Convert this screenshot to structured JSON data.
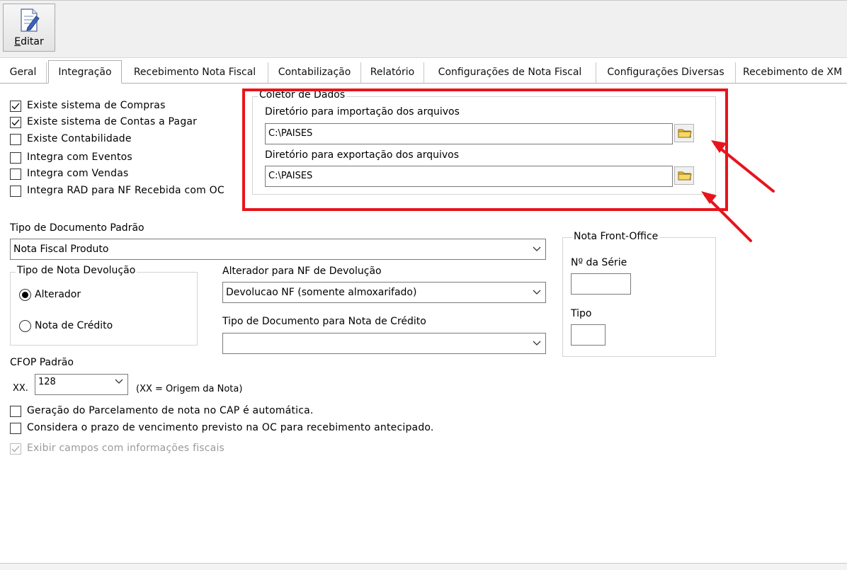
{
  "toolbar": {
    "edit_label_first": "E",
    "edit_label_rest": "ditar",
    "edit_icon": "edit-document-icon"
  },
  "tabs": [
    "Geral",
    "Integração",
    "Recebimento Nota Fiscal",
    "Contabilização",
    "Relatório",
    "Configurações de Nota Fiscal",
    "Configurações Diversas",
    "Recebimento de XM"
  ],
  "active_tab": "Integração",
  "checks": [
    {
      "label": "Existe sistema de Compras",
      "checked": true
    },
    {
      "label": "Existe sistema de Contas a Pagar",
      "checked": true
    },
    {
      "label": "Existe Contabilidade",
      "checked": false
    },
    {
      "label": "Integra com Eventos",
      "checked": false
    },
    {
      "label": "Integra com Vendas",
      "checked": false
    },
    {
      "label": "Integra RAD para NF Recebida com OC",
      "checked": false
    }
  ],
  "coletor": {
    "title": "Coletor de Dados",
    "import_label": "Diretório para importação dos arquivos",
    "import_value": "C:\\PAISES",
    "export_label": "Diretório para exportação dos arquivos",
    "export_value": "C:\\PAISES"
  },
  "tipo_documento": {
    "label": "Tipo de Documento Padrão",
    "value": "Nota Fiscal Produto"
  },
  "nota_devolucao": {
    "title": "Tipo de Nota Devolução",
    "opt1": "Alterador",
    "opt2": "Nota de Crédito",
    "selected": "Alterador"
  },
  "alterador": {
    "label": "Alterador para NF de Devolução",
    "value": "Devolucao NF (somente almoxarifado)"
  },
  "tipo_doc_credito": {
    "label": "Tipo de Documento para Nota de Crédito",
    "value": ""
  },
  "front_office": {
    "title": "Nota Front-Office",
    "serie_label": "Nº da Série",
    "serie_value": "",
    "tipo_label": "Tipo",
    "tipo_value": ""
  },
  "cfop": {
    "label": "CFOP Padrão",
    "prefix": "XX.",
    "value": "128",
    "hint": "(XX = Origem da Nota)"
  },
  "bottom_checks": [
    {
      "label": "Geração do Parcelamento de nota no CAP é automática.",
      "checked": false,
      "disabled": false
    },
    {
      "label": "Considera o prazo de vencimento previsto na OC para recebimento antecipado.",
      "checked": false,
      "disabled": false
    },
    {
      "label": "Exibir campos com informações fiscais",
      "checked": true,
      "disabled": true
    }
  ],
  "colors": {
    "highlight": "#e8141c",
    "folder": "#f2c12e"
  }
}
